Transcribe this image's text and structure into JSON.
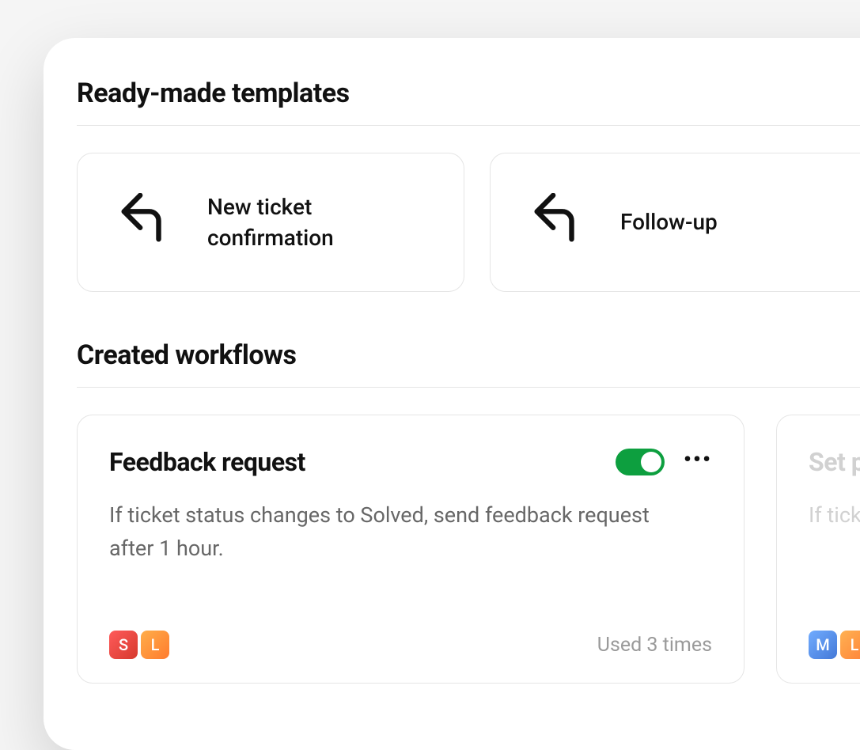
{
  "sections": {
    "templates_title": "Ready-made templates",
    "workflows_title": "Created workflows"
  },
  "templates": [
    {
      "icon": "reply-arrow",
      "label": "New ticket confirmation"
    },
    {
      "icon": "reply-arrow",
      "label": "Follow-up"
    }
  ],
  "workflows": [
    {
      "title": "Feedback request",
      "enabled": true,
      "description": "If ticket status changes to Solved, send feedback request after 1 hour.",
      "badges": [
        {
          "letter": "S",
          "color": "s"
        },
        {
          "letter": "L",
          "color": "l"
        }
      ],
      "usage": "Used 3 times",
      "more_icon": "•••"
    },
    {
      "title": "Set p",
      "enabled": true,
      "description": "If tick\nreque",
      "badges": [
        {
          "letter": "M",
          "color": "m"
        },
        {
          "letter": "L",
          "color": "l"
        }
      ],
      "usage": "",
      "more_icon": "•••"
    }
  ],
  "colors": {
    "toggle_on": "#0d9f3f",
    "border": "#e5e5e5",
    "text_primary": "#111",
    "text_secondary": "#676767",
    "text_muted": "#9a9a9a"
  }
}
